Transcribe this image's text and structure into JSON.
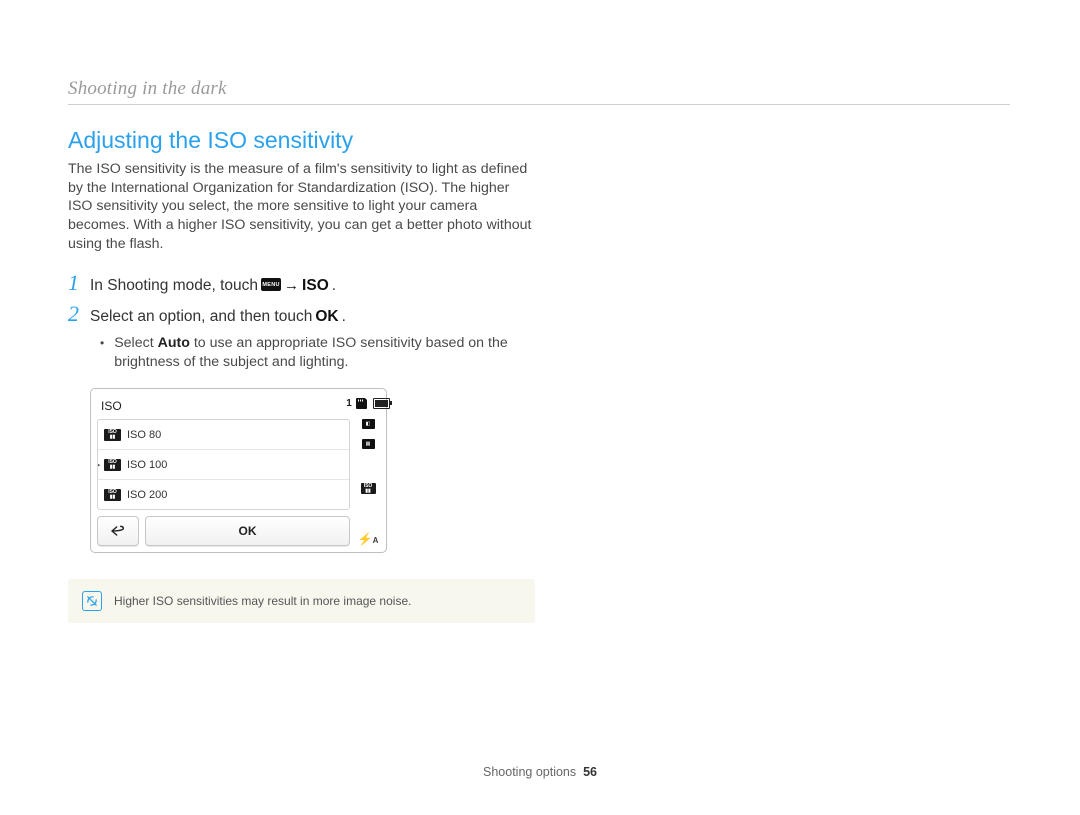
{
  "chapter": "Shooting in the dark",
  "heading": "Adjusting the ISO sensitivity",
  "intro": "The ISO sensitivity is the measure of a film's sensitivity to light as defined by the International Organization for Standardization (ISO). The higher ISO sensitivity you select, the more sensitive to light your camera becomes. With a higher ISO sensitivity, you can get a better photo without using the flash.",
  "steps": {
    "s1_num": "1",
    "s1_pre": "In Shooting mode, touch ",
    "s1_menu": "MENU",
    "s1_arrow": "→",
    "s1_iso": "ISO",
    "s1_post": ".",
    "s2_num": "2",
    "s2_pre": "Select an option, and then touch ",
    "s2_ok": "OK",
    "s2_post": "."
  },
  "bullet": {
    "pre": "Select ",
    "bold": "Auto",
    "post": " to use an appropriate ISO sensitivity based on the brightness of the subject and lighting."
  },
  "screen": {
    "title": "ISO",
    "options": [
      "ISO 80",
      "ISO 100",
      "ISO 200"
    ],
    "selected_index": 1,
    "back_label": "↶",
    "ok_label": "OK",
    "top_count": "1"
  },
  "note": "Higher ISO sensitivities may result in more image noise.",
  "footer": {
    "section": "Shooting options",
    "page": "56"
  }
}
